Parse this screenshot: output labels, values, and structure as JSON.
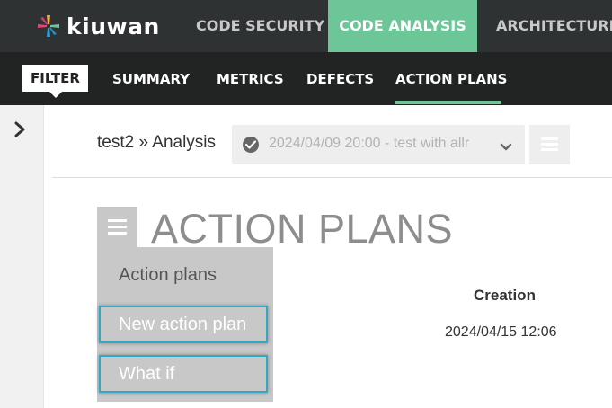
{
  "header": {
    "logo_text": "kiuwan",
    "tabs": [
      {
        "label": "CODE SECURITY",
        "active": false
      },
      {
        "label": "CODE ANALYSIS",
        "active": true
      },
      {
        "label": "ARCHITECTURE",
        "active": false
      }
    ],
    "accent_color": "#6dc698"
  },
  "subnav": {
    "filter_label": "FILTER",
    "tabs": [
      {
        "label": "SUMMARY",
        "active": false
      },
      {
        "label": "METRICS",
        "active": false
      },
      {
        "label": "DEFECTS",
        "active": false
      },
      {
        "label": "ACTION PLANS",
        "active": true
      }
    ]
  },
  "sidebar": {
    "toggle_icon": "chevron-right-icon"
  },
  "breadcrumb": {
    "text": "test2 » Analysis"
  },
  "analysis_select": {
    "value": "2024/04/09 20:00 - test with allr",
    "icon": "check-circle-icon"
  },
  "page": {
    "title": "ACTION PLANS"
  },
  "menu": {
    "header": "Action plans",
    "items": [
      {
        "label": "New action plan"
      },
      {
        "label": "What if"
      }
    ],
    "highlight_color": "#35a6c4"
  },
  "table": {
    "columns": [
      "Creation"
    ],
    "rows": [
      {
        "creation": "2024/04/15 12:06"
      }
    ]
  }
}
